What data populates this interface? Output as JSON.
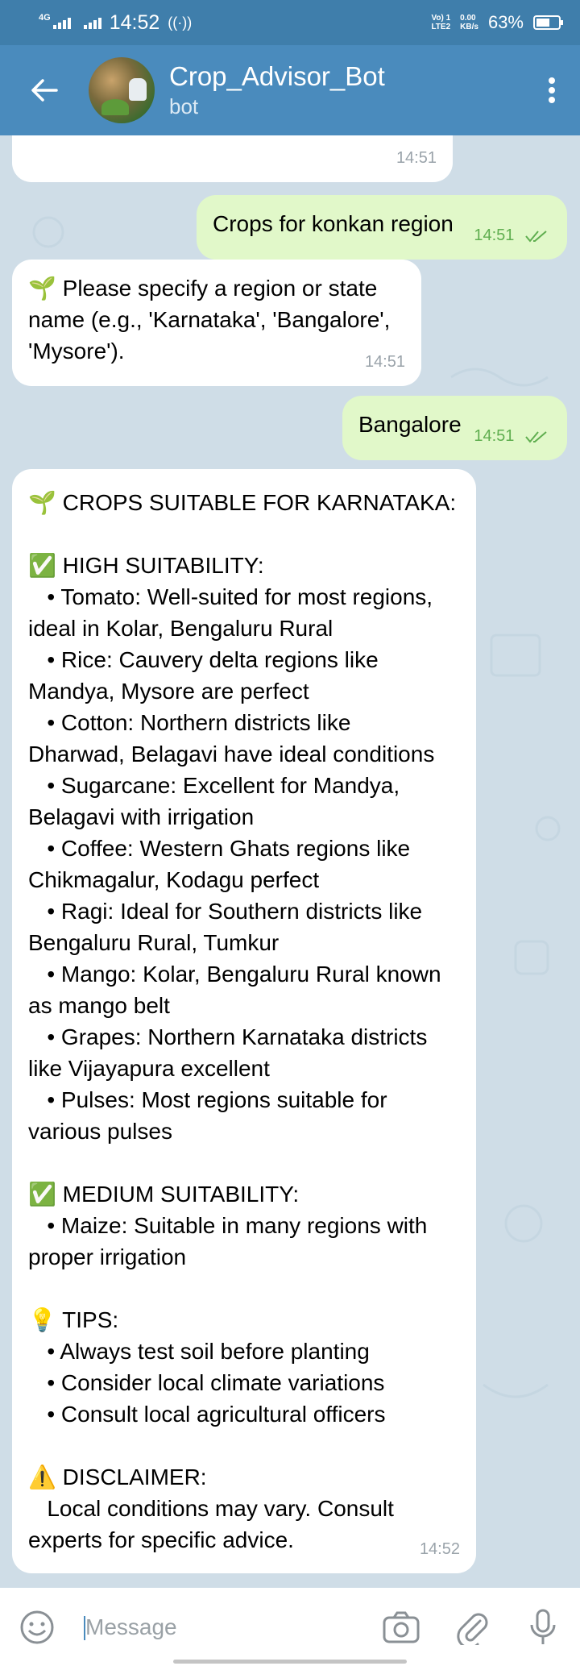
{
  "status_bar": {
    "network_left": "4G",
    "time": "14:52",
    "volte_line1": "Vo) 1",
    "volte_line2": "LTE2",
    "speed_value": "0.00",
    "speed_unit": "KB/s",
    "battery_percent": "63%",
    "battery_level": 0.63
  },
  "header": {
    "bot_name": "Crop_Advisor_Bot",
    "subtitle": "bot"
  },
  "messages": [
    {
      "id": "m0",
      "direction": "in",
      "text": "",
      "time": "14:51"
    },
    {
      "id": "m1",
      "direction": "out",
      "text": "Crops for konkan region",
      "time": "14:51"
    },
    {
      "id": "m2",
      "direction": "in",
      "text": "🌱 Please specify a region or state\nname (e.g., 'Karnataka', 'Bangalore',\n'Mysore').",
      "time": "14:51"
    },
    {
      "id": "m3",
      "direction": "out",
      "text": "Bangalore",
      "time": "14:51"
    },
    {
      "id": "m4",
      "direction": "in",
      "text": "🌱 CROPS SUITABLE FOR KARNATAKA:\n\n✅ HIGH SUITABILITY:\n   • Tomato: Well-suited for most regions,\nideal in Kolar, Bengaluru Rural\n   • Rice: Cauvery delta regions like\nMandya, Mysore are perfect\n   • Cotton: Northern districts like\nDharwad, Belagavi have ideal conditions\n   • Sugarcane: Excellent for Mandya,\nBelagavi with irrigation\n   • Coffee: Western Ghats regions like\nChikmagalur, Kodagu perfect\n   • Ragi: Ideal for Southern districts like\nBengaluru Rural, Tumkur\n   • Mango: Kolar, Bengaluru Rural known\nas mango belt\n   • Grapes: Northern Karnataka districts\nlike Vijayapura excellent\n   • Pulses: Most regions suitable for\nvarious pulses\n\n✅ MEDIUM SUITABILITY:\n   • Maize: Suitable in many regions with\nproper irrigation\n\n💡 TIPS:\n   • Always test soil before planting\n   • Consider local climate variations\n   • Consult local agricultural officers\n\n⚠️ DISCLAIMER:\n   Local conditions may vary. Consult\nexperts for specific advice.",
      "time": "14:52"
    }
  ],
  "input": {
    "placeholder": "Message"
  },
  "colors": {
    "status_bar": "#3f7eab",
    "header": "#4a8bbd",
    "chat_bg": "#cfdde7",
    "incoming_bubble": "#ffffff",
    "outgoing_bubble": "#e1f8c9",
    "outgoing_time": "#5fae4f"
  },
  "icons": {
    "back": "arrow-left-icon",
    "menu": "more-vertical-icon",
    "emoji": "emoji-icon",
    "camera": "camera-icon",
    "attach": "paperclip-icon",
    "mic": "microphone-icon"
  }
}
